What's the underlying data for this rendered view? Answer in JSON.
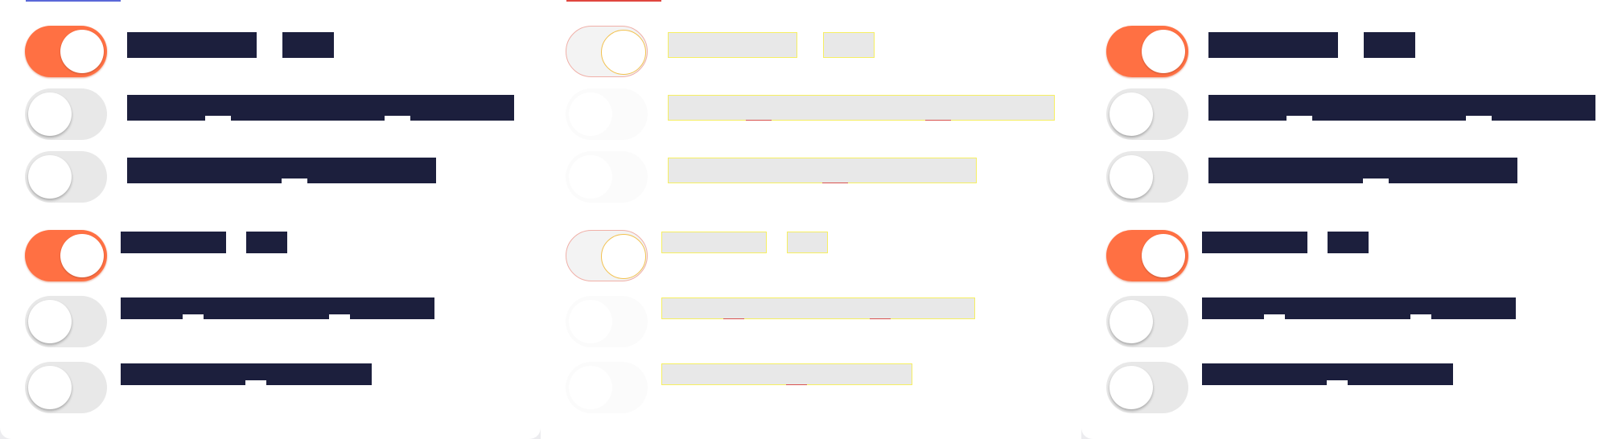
{
  "theme": {
    "toggle_on": "#ff7043",
    "toggle_off": "#e8e8e8",
    "label_bar": "#1c1f3d",
    "skeleton_bar": "#e8e8e8",
    "panel_background": "#ffffff",
    "tab_markers": [
      "#5a68d8",
      "#e0463f"
    ]
  },
  "panels": [
    {
      "state": "loaded",
      "groups": [
        {
          "size": "large",
          "toggles": [
            {
              "checked": true
            },
            {
              "checked": false
            },
            {
              "checked": false
            }
          ]
        },
        {
          "size": "small",
          "toggles": [
            {
              "checked": true
            },
            {
              "checked": false
            },
            {
              "checked": false
            }
          ]
        }
      ]
    },
    {
      "state": "loading-skeleton",
      "groups": [
        {
          "size": "large",
          "toggles": [
            {
              "checked": true
            },
            {
              "checked": false
            },
            {
              "checked": false
            }
          ]
        },
        {
          "size": "small",
          "toggles": [
            {
              "checked": true
            },
            {
              "checked": false
            },
            {
              "checked": false
            }
          ]
        }
      ]
    },
    {
      "state": "loaded",
      "groups": [
        {
          "size": "large",
          "toggles": [
            {
              "checked": true
            },
            {
              "checked": false
            },
            {
              "checked": false
            }
          ]
        },
        {
          "size": "small",
          "toggles": [
            {
              "checked": true
            },
            {
              "checked": false
            },
            {
              "checked": false
            }
          ]
        }
      ]
    }
  ]
}
